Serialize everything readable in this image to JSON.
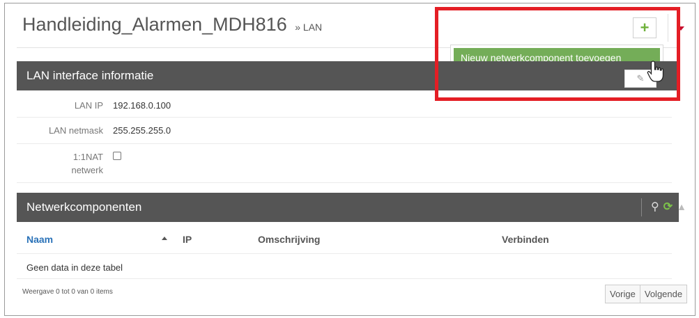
{
  "header": {
    "title": "Handleiding_Alarmen_MDH816",
    "breadcrumb": "» LAN",
    "add_button": "+"
  },
  "dropdown": {
    "item": "Nieuw netwerkcomponent toevoegen"
  },
  "lan_panel": {
    "title": "LAN interface informatie",
    "rows": [
      {
        "label": "LAN IP",
        "value": "192.168.0.100"
      },
      {
        "label": "LAN netmask",
        "value": "255.255.255.0"
      },
      {
        "label": "1:1NAT",
        "label2": "netwerk",
        "checked": false
      }
    ]
  },
  "net_panel": {
    "title": "Netwerkcomponenten",
    "columns": [
      "Naam",
      "IP",
      "Omschrijving",
      "Verbinden"
    ],
    "empty": "Geen data in deze tabel",
    "footer": "Weergave 0 tot 0 van 0 items",
    "prev": "Vorige",
    "next": "Volgende"
  },
  "colors": {
    "panel_header": "#555555",
    "accent_green": "#74ad58",
    "highlight_red": "#e41e25",
    "link_blue": "#2a72b8"
  }
}
